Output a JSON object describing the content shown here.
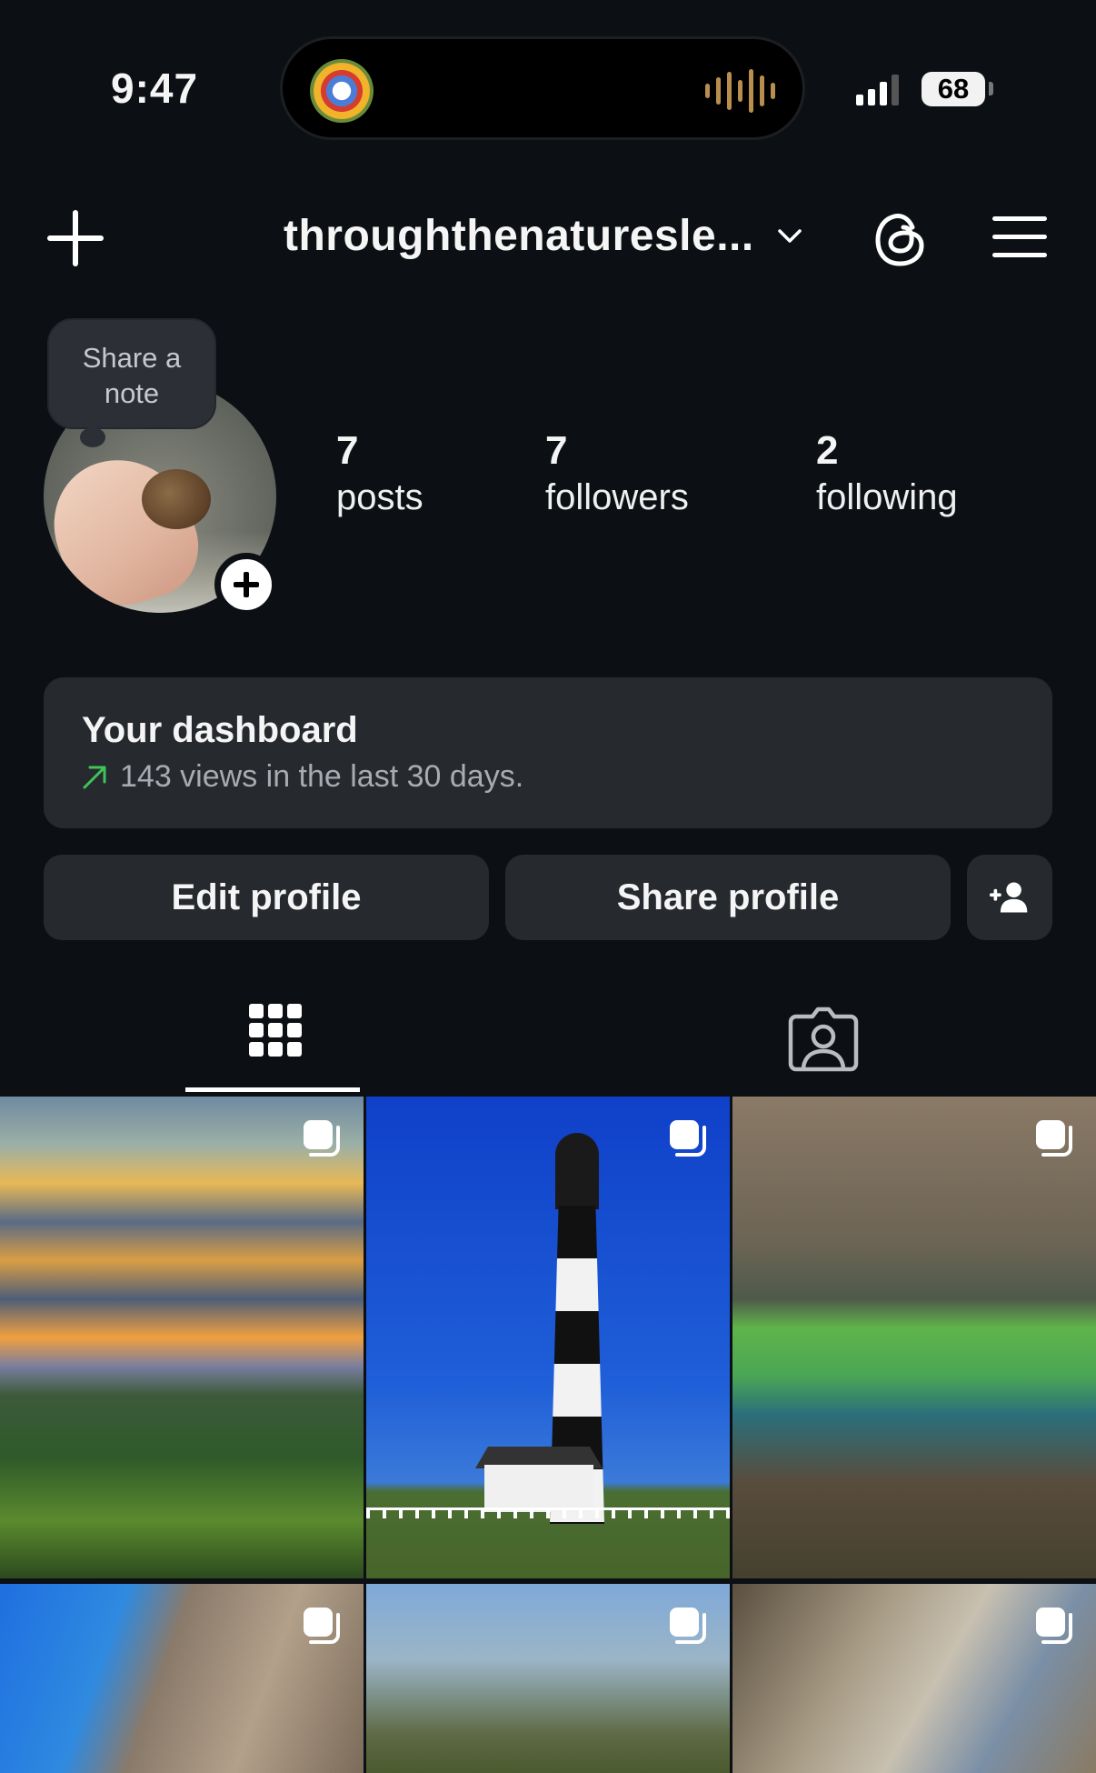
{
  "status_bar": {
    "time": "9:47",
    "battery": "68"
  },
  "header": {
    "username": "throughthenaturesle..."
  },
  "note": {
    "line1": "Share a",
    "line2": "note"
  },
  "stats": [
    {
      "value": "7",
      "label": "posts"
    },
    {
      "value": "7",
      "label": "followers"
    },
    {
      "value": "2",
      "label": "following"
    }
  ],
  "dashboard": {
    "title": "Your dashboard",
    "subtitle": "143 views in the last 30 days.",
    "trend_color": "#3fc45a"
  },
  "buttons": {
    "edit": "Edit profile",
    "share": "Share profile"
  },
  "tabs": [
    "grid-icon",
    "tagged-icon"
  ],
  "posts": [
    {
      "subject": "sunset over forested mountains"
    },
    {
      "subject": "black and white striped lighthouse"
    },
    {
      "subject": "green spring pool in forest"
    },
    {
      "subject": "rock arch against blue sky"
    },
    {
      "subject": "wooded ravine with bare trees"
    },
    {
      "subject": "rocky canyon with trees"
    }
  ],
  "colors": {
    "background": "#0c1014",
    "surface": "#262a2f",
    "text": "#f5f5f5",
    "muted": "#a8abb0"
  }
}
